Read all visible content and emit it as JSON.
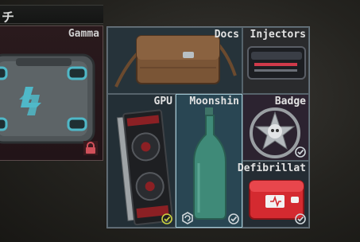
{
  "left_panel": {
    "header_text": "チ",
    "container_label": "Gamma",
    "locked": true
  },
  "grid": {
    "items": [
      {
        "id": "docs",
        "label": "Docs",
        "checked": false
      },
      {
        "id": "injectors",
        "label": "Injectors",
        "checked": false
      },
      {
        "id": "gpu",
        "label": "GPU",
        "checked": true
      },
      {
        "id": "moonshine",
        "label": "Moonshin",
        "checked": true,
        "selected": true
      },
      {
        "id": "badge",
        "label": "Badge",
        "checked": true
      },
      {
        "id": "defibrillator",
        "label": "Defibrillat",
        "checked": true
      }
    ]
  },
  "colors": {
    "selected_border": "#9fc4d0",
    "grid_border": "#6b7780",
    "lock_red": "#d0505a",
    "check_color": "#cfd6da",
    "gpu_check_color": "#c8d040"
  }
}
